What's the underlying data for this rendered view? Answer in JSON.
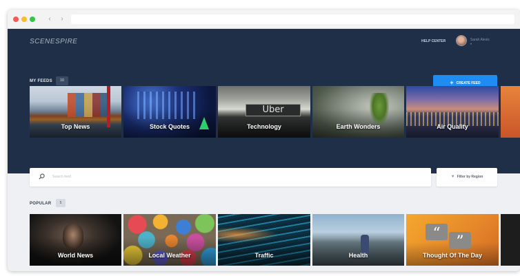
{
  "window": {
    "nav_back": "‹",
    "nav_forward": "›"
  },
  "header": {
    "logo": "SCENESPIRE",
    "help_center": "HELP CENTER",
    "username": "Sarah Alexis",
    "avatar_icon": "avatar-image"
  },
  "my_feeds": {
    "label": "MY FEEDS",
    "count": "10",
    "create_button": "CREATE FEED",
    "tiles": [
      {
        "label": "Top News"
      },
      {
        "label": "Stock Quotes"
      },
      {
        "label": "Technology"
      },
      {
        "label": "Earth Wonders"
      },
      {
        "label": "Air Quality"
      }
    ]
  },
  "search": {
    "placeholder": "Search feed",
    "icon": "search-icon"
  },
  "filter": {
    "label": "Filter by Region",
    "icon": "filter-icon"
  },
  "popular": {
    "label": "POPULAR",
    "count": "5",
    "tiles": [
      {
        "label": "World News"
      },
      {
        "label": "Local Weather"
      },
      {
        "label": "Traffic"
      },
      {
        "label": "Health"
      },
      {
        "label": "Thought Of The Day"
      }
    ]
  },
  "colors": {
    "header_bg": "#1f2f48",
    "accent": "#1f8cf2",
    "page_bg": "#eef0f3"
  }
}
